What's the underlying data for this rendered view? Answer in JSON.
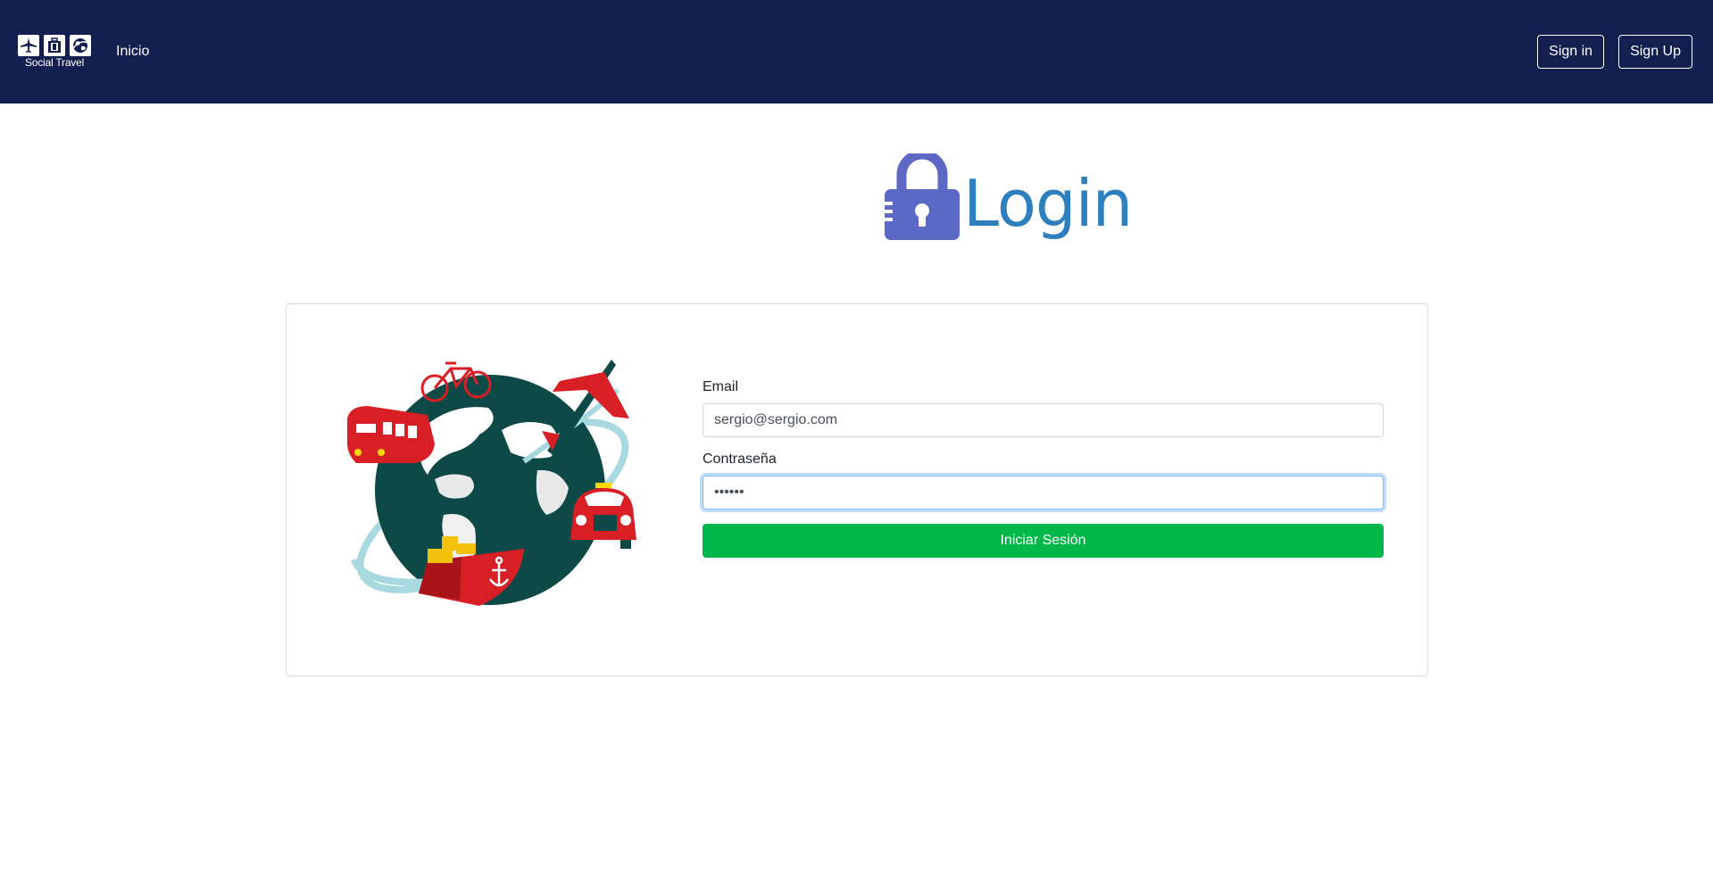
{
  "navbar": {
    "brand_text": "Social Travel",
    "brand_icons": [
      "airplane-icon",
      "luggage-icon",
      "globe-icon"
    ],
    "home_link": "Inicio",
    "sign_in_label": "Sign in",
    "sign_up_label": "Sign Up",
    "background_color": "#131f4e"
  },
  "page": {
    "heading": "Login",
    "heading_icon": "padlock-icon",
    "heading_color": "#2e7fbd",
    "lock_color": "#5b68c4"
  },
  "form": {
    "email_label": "Email",
    "email_value": "sergio@sergio.com",
    "password_label": "Contraseña",
    "password_value": "••••••",
    "submit_label": "Iniciar Sesión",
    "submit_color": "#00b74a"
  },
  "illustration": {
    "name": "travel-globe-illustration"
  }
}
